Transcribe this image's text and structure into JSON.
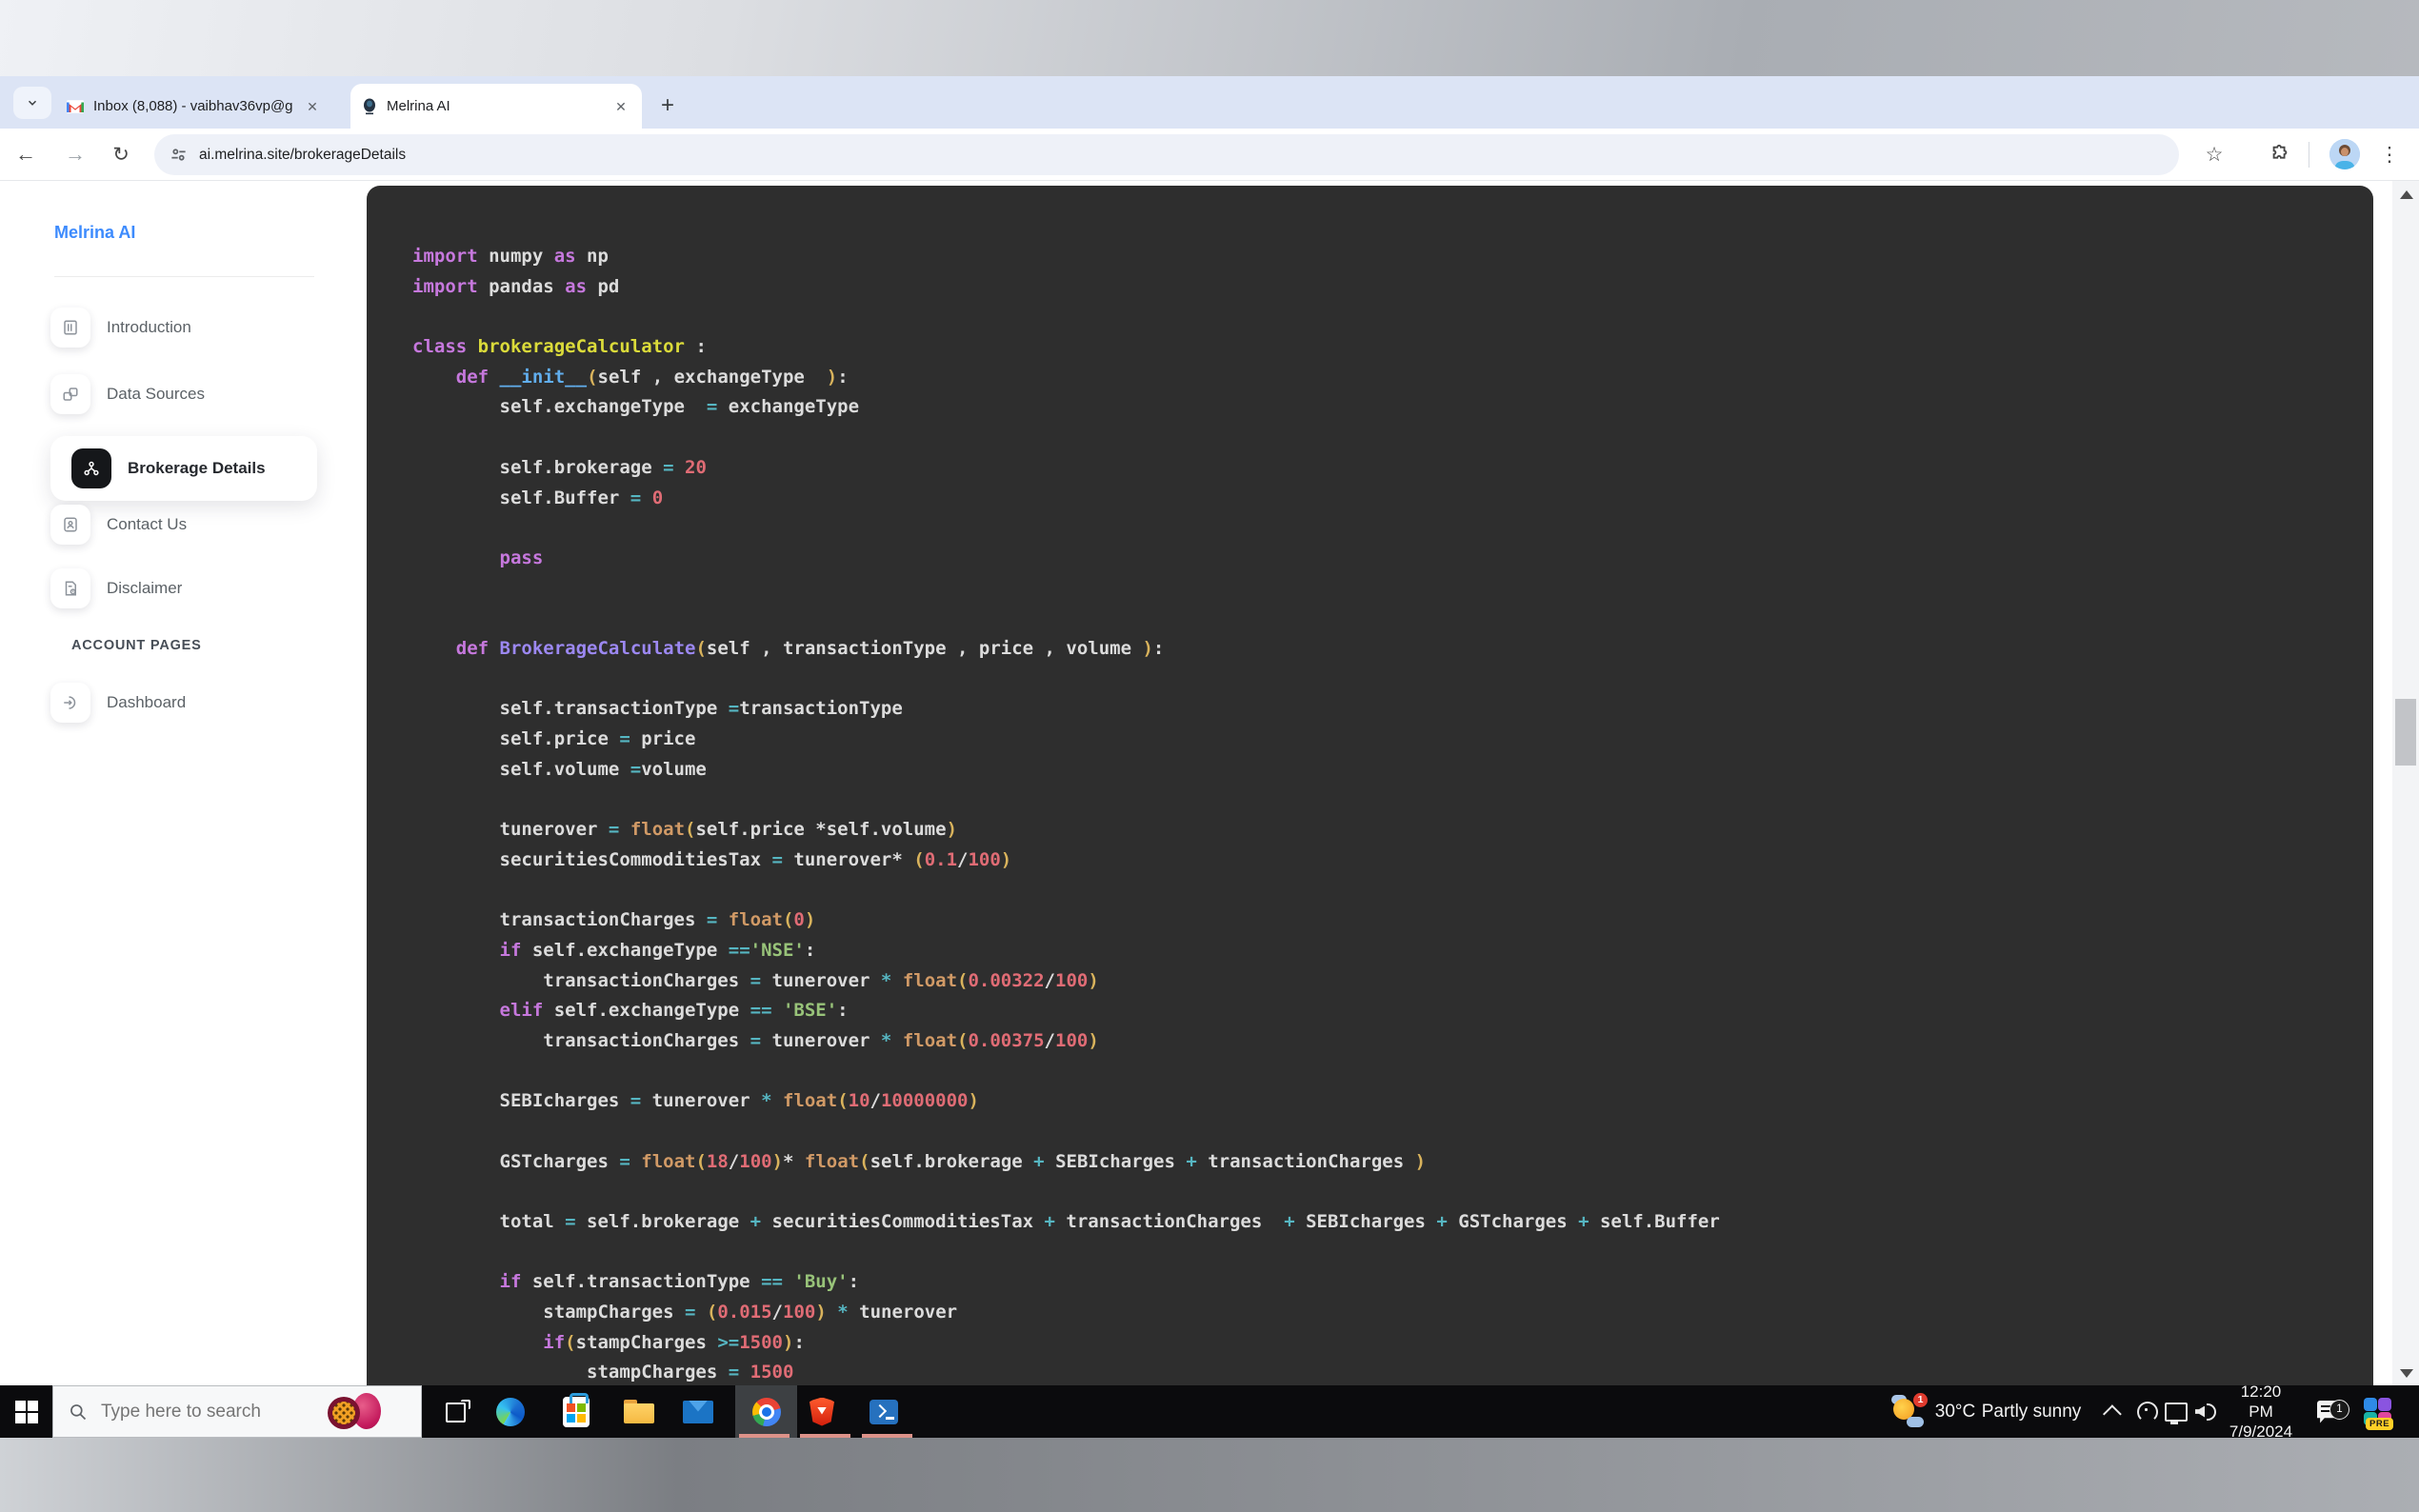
{
  "icons": {
    "close": "✕",
    "new_tab_plus": "+",
    "window_minimize": "—",
    "nav_back": "←",
    "nav_forward": "→",
    "reload": "↻",
    "bookmark_star": "☆",
    "menu_kebab": "⋮"
  },
  "browser": {
    "tabs": [
      {
        "title": "Inbox (8,088) - vaibhav36vp@g"
      },
      {
        "title": "Melrina AI"
      }
    ],
    "toolbar": {
      "url": "ai.melrina.site/brokerageDetails"
    }
  },
  "sidebar": {
    "brand": "Melrina AI",
    "items": [
      {
        "label": "Introduction"
      },
      {
        "label": "Data Sources"
      },
      {
        "label": "Brokerage Details",
        "active": true
      },
      {
        "label": "Contact Us"
      },
      {
        "label": "Disclaimer"
      }
    ],
    "section": "ACCOUNT PAGES",
    "account_items": [
      {
        "label": "Dashboard"
      }
    ]
  },
  "code": {
    "lines": [
      [
        [
          "k",
          "import"
        ],
        [
          "t",
          " numpy "
        ],
        [
          "k",
          "as"
        ],
        [
          "t",
          " np"
        ]
      ],
      [
        [
          "k",
          "import"
        ],
        [
          "t",
          " pandas "
        ],
        [
          "k",
          "as"
        ],
        [
          "t",
          " pd"
        ]
      ],
      [],
      [
        [
          "k",
          "class"
        ],
        [
          "t",
          " "
        ],
        [
          "cls",
          "brokerageCalculator"
        ],
        [
          "t",
          " :"
        ]
      ],
      [
        [
          "t",
          "    "
        ],
        [
          "k",
          "def"
        ],
        [
          "t",
          " "
        ],
        [
          "fnb",
          "__init__"
        ],
        [
          "p",
          "("
        ],
        [
          "t",
          "self , exchangeType  "
        ],
        [
          "p",
          ")"
        ],
        [
          "t",
          ":"
        ]
      ],
      [
        [
          "t",
          "        self.exchangeType  "
        ],
        [
          "o",
          "="
        ],
        [
          "t",
          " exchangeType"
        ]
      ],
      [],
      [
        [
          "t",
          "        self.brokerage "
        ],
        [
          "o",
          "="
        ],
        [
          "t",
          " "
        ],
        [
          "n",
          "20"
        ]
      ],
      [
        [
          "t",
          "        self.Buffer "
        ],
        [
          "o",
          "="
        ],
        [
          "t",
          " "
        ],
        [
          "n",
          "0"
        ]
      ],
      [],
      [
        [
          "t",
          "        "
        ],
        [
          "k",
          "pass"
        ]
      ],
      [],
      [],
      [
        [
          "t",
          "    "
        ],
        [
          "k",
          "def"
        ],
        [
          "t",
          " "
        ],
        [
          "fnp",
          "BrokerageCalculate"
        ],
        [
          "p",
          "("
        ],
        [
          "t",
          "self , transactionType , price , volume "
        ],
        [
          "p",
          ")"
        ],
        [
          "t",
          ":"
        ]
      ],
      [],
      [
        [
          "t",
          "        self.transactionType "
        ],
        [
          "o",
          "="
        ],
        [
          "t",
          "transactionType"
        ]
      ],
      [
        [
          "t",
          "        self.price "
        ],
        [
          "o",
          "="
        ],
        [
          "t",
          " price"
        ]
      ],
      [
        [
          "t",
          "        self.volume "
        ],
        [
          "o",
          "="
        ],
        [
          "t",
          "volume"
        ]
      ],
      [],
      [
        [
          "t",
          "        tunerover "
        ],
        [
          "o",
          "="
        ],
        [
          "t",
          " "
        ],
        [
          "b",
          "float"
        ],
        [
          "p",
          "("
        ],
        [
          "t",
          "self.price *self.volume"
        ],
        [
          "p",
          ")"
        ]
      ],
      [
        [
          "t",
          "        securitiesCommoditiesTax "
        ],
        [
          "o",
          "="
        ],
        [
          "t",
          " tunerover* "
        ],
        [
          "p",
          "("
        ],
        [
          "n",
          "0.1"
        ],
        [
          "t",
          "/"
        ],
        [
          "n",
          "100"
        ],
        [
          "p",
          ")"
        ]
      ],
      [],
      [
        [
          "t",
          "        transactionCharges "
        ],
        [
          "o",
          "="
        ],
        [
          "t",
          " "
        ],
        [
          "b",
          "float"
        ],
        [
          "p",
          "("
        ],
        [
          "n",
          "0"
        ],
        [
          "p",
          ")"
        ]
      ],
      [
        [
          "t",
          "        "
        ],
        [
          "k",
          "if"
        ],
        [
          "t",
          " self.exchangeType "
        ],
        [
          "o",
          "=="
        ],
        [
          "s",
          "'NSE'"
        ],
        [
          "t",
          ":"
        ]
      ],
      [
        [
          "t",
          "            transactionCharges "
        ],
        [
          "o",
          "="
        ],
        [
          "t",
          " tunerover "
        ],
        [
          "o",
          "*"
        ],
        [
          "t",
          " "
        ],
        [
          "b",
          "float"
        ],
        [
          "p",
          "("
        ],
        [
          "n",
          "0.00322"
        ],
        [
          "t",
          "/"
        ],
        [
          "n",
          "100"
        ],
        [
          "p",
          ")"
        ]
      ],
      [
        [
          "t",
          "        "
        ],
        [
          "k",
          "elif"
        ],
        [
          "t",
          " self.exchangeType "
        ],
        [
          "o",
          "=="
        ],
        [
          "t",
          " "
        ],
        [
          "s",
          "'BSE'"
        ],
        [
          "t",
          ":"
        ]
      ],
      [
        [
          "t",
          "            transactionCharges "
        ],
        [
          "o",
          "="
        ],
        [
          "t",
          " tunerover "
        ],
        [
          "o",
          "*"
        ],
        [
          "t",
          " "
        ],
        [
          "b",
          "float"
        ],
        [
          "p",
          "("
        ],
        [
          "n",
          "0.00375"
        ],
        [
          "t",
          "/"
        ],
        [
          "n",
          "100"
        ],
        [
          "p",
          ")"
        ]
      ],
      [],
      [
        [
          "t",
          "        SEBIcharges "
        ],
        [
          "o",
          "="
        ],
        [
          "t",
          " tunerover "
        ],
        [
          "o",
          "*"
        ],
        [
          "t",
          " "
        ],
        [
          "b",
          "float"
        ],
        [
          "p",
          "("
        ],
        [
          "n",
          "10"
        ],
        [
          "t",
          "/"
        ],
        [
          "n",
          "10000000"
        ],
        [
          "p",
          ")"
        ]
      ],
      [],
      [
        [
          "t",
          "        GSTcharges "
        ],
        [
          "o",
          "="
        ],
        [
          "t",
          " "
        ],
        [
          "b",
          "float"
        ],
        [
          "p",
          "("
        ],
        [
          "n",
          "18"
        ],
        [
          "t",
          "/"
        ],
        [
          "n",
          "100"
        ],
        [
          "p",
          ")"
        ],
        [
          "t",
          "* "
        ],
        [
          "b",
          "float"
        ],
        [
          "p",
          "("
        ],
        [
          "t",
          "self.brokerage "
        ],
        [
          "o",
          "+"
        ],
        [
          "t",
          " SEBIcharges "
        ],
        [
          "o",
          "+"
        ],
        [
          "t",
          " transactionCharges "
        ],
        [
          "p",
          ")"
        ]
      ],
      [],
      [
        [
          "t",
          "        total "
        ],
        [
          "o",
          "="
        ],
        [
          "t",
          " self.brokerage "
        ],
        [
          "o",
          "+"
        ],
        [
          "t",
          " securitiesCommoditiesTax "
        ],
        [
          "o",
          "+"
        ],
        [
          "t",
          " transactionCharges  "
        ],
        [
          "o",
          "+"
        ],
        [
          "t",
          " SEBIcharges "
        ],
        [
          "o",
          "+"
        ],
        [
          "t",
          " GSTcharges "
        ],
        [
          "o",
          "+"
        ],
        [
          "t",
          " self.Buffer"
        ]
      ],
      [],
      [
        [
          "t",
          "        "
        ],
        [
          "k",
          "if"
        ],
        [
          "t",
          " self.transactionType "
        ],
        [
          "o",
          "=="
        ],
        [
          "t",
          " "
        ],
        [
          "s",
          "'Buy'"
        ],
        [
          "t",
          ":"
        ]
      ],
      [
        [
          "t",
          "            stampCharges "
        ],
        [
          "o",
          "="
        ],
        [
          "t",
          " "
        ],
        [
          "p",
          "("
        ],
        [
          "n",
          "0.015"
        ],
        [
          "t",
          "/"
        ],
        [
          "n",
          "100"
        ],
        [
          "p",
          ")"
        ],
        [
          "t",
          " "
        ],
        [
          "o",
          "*"
        ],
        [
          "t",
          " tunerover"
        ]
      ],
      [
        [
          "t",
          "            "
        ],
        [
          "k",
          "if"
        ],
        [
          "p",
          "("
        ],
        [
          "t",
          "stampCharges "
        ],
        [
          "o",
          ">="
        ],
        [
          "n",
          "1500"
        ],
        [
          "p",
          ")"
        ],
        [
          "t",
          ":"
        ]
      ],
      [
        [
          "t",
          "                stampCharges "
        ],
        [
          "o",
          "="
        ],
        [
          "t",
          " "
        ],
        [
          "n",
          "1500"
        ]
      ]
    ]
  },
  "taskbar": {
    "search_placeholder": "Type here to search",
    "apps": [
      "task-view",
      "edge",
      "microsoft-store",
      "file-explorer",
      "mail",
      "chrome",
      "brave",
      "powershell"
    ],
    "tray": {
      "weather_badge": "1",
      "temperature": "30°C",
      "condition": "Partly sunny",
      "time": "12:20 PM",
      "date": "7/9/2024",
      "notification_count": "1",
      "copilot_badge": "PRE"
    }
  },
  "colors": {
    "accent_blue": "#3d8bfd",
    "code_background": "#2e2e2e",
    "tab_strip": "#dce4f5",
    "running_indicator": "#dd9289"
  }
}
